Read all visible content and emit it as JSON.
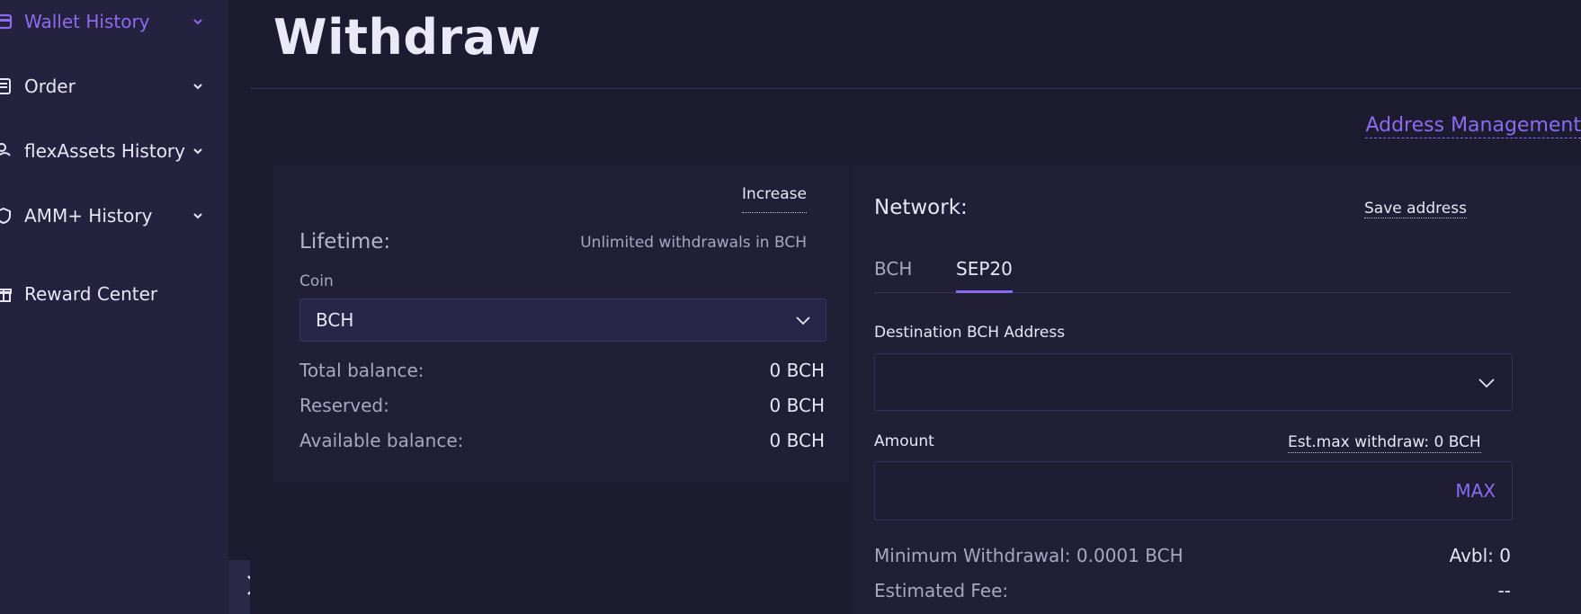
{
  "colors": {
    "accent": "#8b6cf0",
    "sidebar_bg": "#24223e",
    "page_bg": "#1c1b30",
    "card_bg": "#201f36"
  },
  "sidebar": {
    "items": [
      {
        "label": "Wallet History",
        "icon": "wallet-icon",
        "active": true,
        "has_chevron": true
      },
      {
        "label": "Order",
        "icon": "order-icon",
        "active": false,
        "has_chevron": true
      },
      {
        "label": "flexAssets History",
        "icon": "coins-icon",
        "active": false,
        "has_chevron": true
      },
      {
        "label": "AMM+ History",
        "icon": "shield-icon",
        "active": false,
        "has_chevron": true
      },
      {
        "label": "Reward Center",
        "icon": "gift-icon",
        "active": false,
        "has_chevron": false
      }
    ],
    "collapse_icon": "chevron-right-icon"
  },
  "header": {
    "title": "Withdraw",
    "address_management": "Address Management"
  },
  "left_card": {
    "increase": "Increase",
    "lifetime_label": "Lifetime:",
    "lifetime_value": "Unlimited withdrawals in BCH",
    "coin_label": "Coin",
    "coin_selected": "BCH",
    "balances": [
      {
        "label": "Total balance:",
        "value": "0 BCH"
      },
      {
        "label": "Reserved:",
        "value": "0 BCH"
      },
      {
        "label": "Available balance:",
        "value": "0 BCH"
      }
    ]
  },
  "right_card": {
    "network_label": "Network:",
    "save_address": "Save address",
    "tabs": [
      {
        "label": "BCH",
        "active": false
      },
      {
        "label": "SEP20",
        "active": true
      }
    ],
    "destination_label": "Destination BCH Address",
    "destination_value": "",
    "amount_label": "Amount",
    "est_max": "Est.max withdraw: 0 BCH",
    "amount_value": "",
    "max_label": "MAX",
    "min_withdrawal": "Minimum Withdrawal: 0.0001 BCH",
    "avbl": "Avbl: 0",
    "fee_label": "Estimated Fee:",
    "fee_value": "--"
  }
}
